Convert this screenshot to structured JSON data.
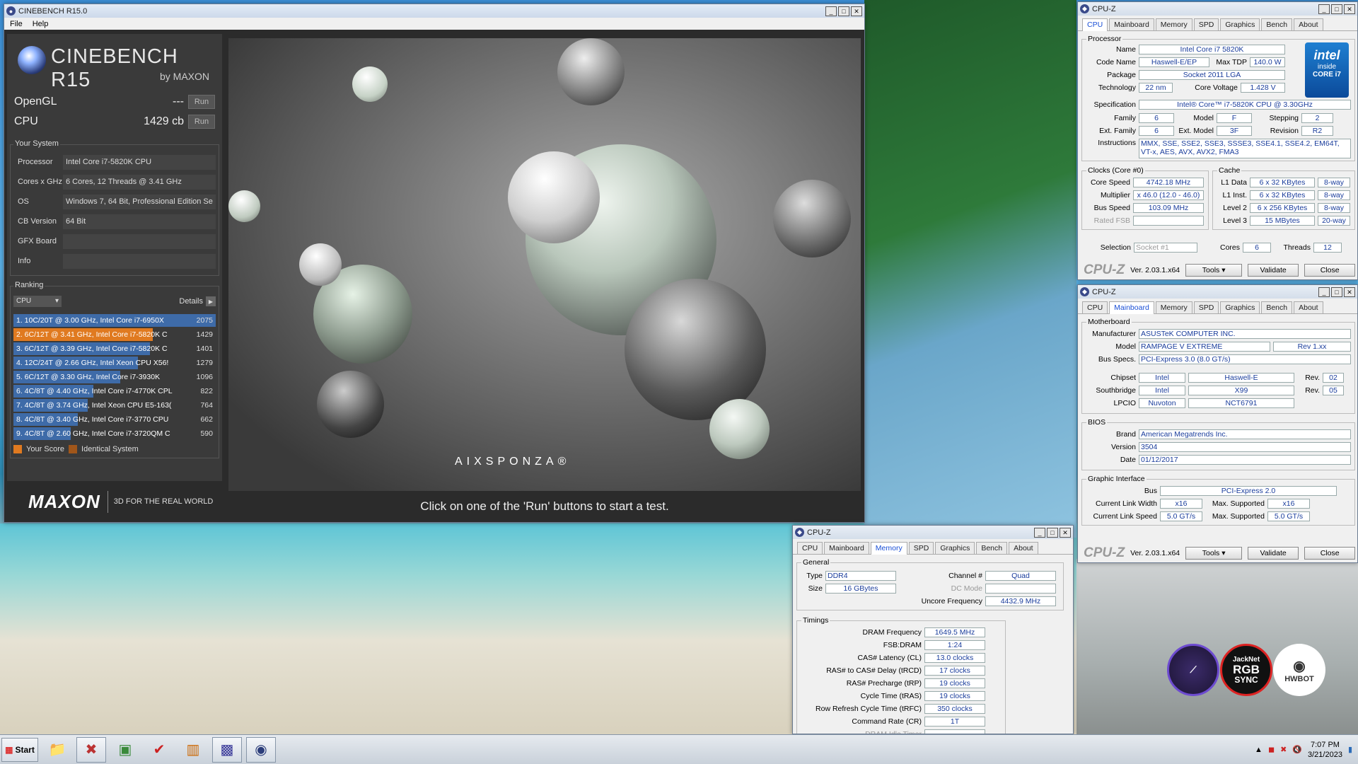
{
  "cinebench": {
    "title": "CINEBENCH R15.0",
    "menu": [
      "File",
      "Help"
    ],
    "logo_title": "CINEBENCH R15",
    "logo_sub": "by MAXON",
    "tests": [
      {
        "label": "OpenGL",
        "value": "---",
        "btn": "Run"
      },
      {
        "label": "CPU",
        "value": "1429 cb",
        "btn": "Run"
      }
    ],
    "your_system_label": "Your System",
    "system": [
      {
        "k": "Processor",
        "v": "Intel Core i7-5820K CPU"
      },
      {
        "k": "Cores x GHz",
        "v": "6 Cores, 12 Threads @ 3.41 GHz"
      },
      {
        "k": "OS",
        "v": "Windows 7, 64 Bit, Professional Edition Se"
      },
      {
        "k": "CB Version",
        "v": "64 Bit"
      },
      {
        "k": "GFX Board",
        "v": ""
      },
      {
        "k": "Info",
        "v": ""
      }
    ],
    "ranking_label": "Ranking",
    "ranking_select": "CPU",
    "details_label": "Details",
    "ranking": [
      {
        "text": "1. 10C/20T @ 3.00 GHz, Intel Core i7-6950X",
        "score": "2075",
        "frac": 1.0,
        "me": false
      },
      {
        "text": "2. 6C/12T @ 3.41 GHz, Intel Core i7-5820K C",
        "score": "1429",
        "frac": 0.69,
        "me": true
      },
      {
        "text": "3. 6C/12T @ 3.39 GHz, Intel Core i7-5820K C",
        "score": "1401",
        "frac": 0.675,
        "me": false
      },
      {
        "text": "4. 12C/24T @ 2.66 GHz, Intel Xeon CPU X56!",
        "score": "1279",
        "frac": 0.616,
        "me": false
      },
      {
        "text": "5. 6C/12T @ 3.30 GHz,  Intel Core i7-3930K",
        "score": "1096",
        "frac": 0.528,
        "me": false
      },
      {
        "text": "6. 4C/8T @ 4.40 GHz, Intel Core i7-4770K CPL",
        "score": "822",
        "frac": 0.396,
        "me": false
      },
      {
        "text": "7. 4C/8T @ 3.74 GHz, Intel Xeon CPU E5-163(",
        "score": "764",
        "frac": 0.368,
        "me": false
      },
      {
        "text": "8. 4C/8T @ 3.40 GHz,  Intel Core i7-3770 CPU",
        "score": "662",
        "frac": 0.319,
        "me": false
      },
      {
        "text": "9. 4C/8T @ 2.60 GHz, Intel Core i7-3720QM C",
        "score": "590",
        "frac": 0.284,
        "me": false
      }
    ],
    "legend_your": "Your Score",
    "legend_ident": "Identical System",
    "footer_brand": "MAXON",
    "footer_slogan": "3D FOR THE REAL WORLD",
    "render_brand": "AIXSPONZA®",
    "message": "Click on one of the 'Run' buttons to start a test."
  },
  "cpuz_cpu": {
    "title": "CPU-Z",
    "tabs": [
      "CPU",
      "Mainboard",
      "Memory",
      "SPD",
      "Graphics",
      "Bench",
      "About"
    ],
    "processor_label": "Processor",
    "name_l": "Name",
    "name": "Intel Core i7 5820K",
    "codename_l": "Code Name",
    "codename": "Haswell-E/EP",
    "tdp_l": "Max TDP",
    "tdp": "140.0 W",
    "package_l": "Package",
    "package": "Socket 2011 LGA",
    "tech_l": "Technology",
    "tech": "22 nm",
    "voltage_l": "Core Voltage",
    "voltage": "1.428 V",
    "spec_l": "Specification",
    "spec": "Intel® Core™ i7-5820K CPU @ 3.30GHz",
    "family_l": "Family",
    "family": "6",
    "model_l": "Model",
    "model": "F",
    "stepping_l": "Stepping",
    "stepping": "2",
    "extfam_l": "Ext. Family",
    "extfam": "6",
    "extmodel_l": "Ext. Model",
    "extmodel": "3F",
    "revision_l": "Revision",
    "revision": "R2",
    "instr_l": "Instructions",
    "instr": "MMX, SSE, SSE2, SSE3, SSSE3, SSE4.1, SSE4.2, EM64T, VT-x, AES, AVX, AVX2, FMA3",
    "clocks_label": "Clocks (Core #0)",
    "corespeed_l": "Core Speed",
    "corespeed": "4742.18 MHz",
    "mult_l": "Multiplier",
    "mult": "x 46.0 (12.0 - 46.0)",
    "bus_l": "Bus Speed",
    "bus": "103.09 MHz",
    "fsb_l": "Rated FSB",
    "fsb": "",
    "cache_label": "Cache",
    "l1d_l": "L1 Data",
    "l1d": "6 x 32 KBytes",
    "l1d_w": "8-way",
    "l1i_l": "L1 Inst.",
    "l1i": "6 x 32 KBytes",
    "l1i_w": "8-way",
    "l2_l": "Level 2",
    "l2": "6 x 256 KBytes",
    "l2_w": "8-way",
    "l3_l": "Level 3",
    "l3": "15 MBytes",
    "l3_w": "20-way",
    "sel_l": "Selection",
    "sel": "Socket #1",
    "cores_l": "Cores",
    "cores": "6",
    "threads_l": "Threads",
    "threads": "12",
    "intel_1": "intel",
    "intel_2": "inside",
    "intel_3": "CORE i7",
    "logo": "CPU-Z",
    "ver": "Ver. 2.03.1.x64",
    "tools": "Tools",
    "validate": "Validate",
    "close": "Close"
  },
  "cpuz_mb": {
    "title": "CPU-Z",
    "tabs": [
      "CPU",
      "Mainboard",
      "Memory",
      "SPD",
      "Graphics",
      "Bench",
      "About"
    ],
    "mb_label": "Motherboard",
    "manu_l": "Manufacturer",
    "manu": "ASUSTeK COMPUTER INC.",
    "model_l": "Model",
    "model": "RAMPAGE V EXTREME",
    "model_rev": "Rev 1.xx",
    "busspec_l": "Bus Specs.",
    "busspec": "PCI-Express 3.0 (8.0 GT/s)",
    "chipset_l": "Chipset",
    "chipset_v": "Intel",
    "chipset_n": "Haswell-E",
    "chipset_rev_l": "Rev.",
    "chipset_rev": "02",
    "south_l": "Southbridge",
    "south_v": "Intel",
    "south_n": "X99",
    "south_rev_l": "Rev.",
    "south_rev": "05",
    "lpcio_l": "LPCIO",
    "lpcio_v": "Nuvoton",
    "lpcio_n": "NCT6791",
    "bios_label": "BIOS",
    "brand_l": "Brand",
    "brand": "American Megatrends Inc.",
    "version_l": "Version",
    "version": "3504",
    "date_l": "Date",
    "date": "01/12/2017",
    "gi_label": "Graphic Interface",
    "gbus_l": "Bus",
    "gbus": "PCI-Express 2.0",
    "clw_l": "Current Link Width",
    "clw": "x16",
    "msw_l": "Max. Supported",
    "msw": "x16",
    "cls_l": "Current Link Speed",
    "cls": "5.0 GT/s",
    "mss_l": "Max. Supported",
    "mss": "5.0 GT/s",
    "logo": "CPU-Z",
    "ver": "Ver. 2.03.1.x64",
    "tools": "Tools",
    "validate": "Validate",
    "close": "Close"
  },
  "cpuz_mem": {
    "title": "CPU-Z",
    "tabs": [
      "CPU",
      "Mainboard",
      "Memory",
      "SPD",
      "Graphics",
      "Bench",
      "About"
    ],
    "general_label": "General",
    "type_l": "Type",
    "type": "DDR4",
    "size_l": "Size",
    "size": "16 GBytes",
    "chan_l": "Channel #",
    "chan": "Quad",
    "dc_l": "DC Mode",
    "dc": "",
    "unc_l": "Uncore Frequency",
    "unc": "4432.9 MHz",
    "timings_label": "Timings",
    "timings": [
      {
        "k": "DRAM Frequency",
        "v": "1649.5 MHz"
      },
      {
        "k": "FSB:DRAM",
        "v": "1:24"
      },
      {
        "k": "CAS# Latency (CL)",
        "v": "13.0 clocks"
      },
      {
        "k": "RAS# to CAS# Delay (tRCD)",
        "v": "17 clocks"
      },
      {
        "k": "RAS# Precharge (tRP)",
        "v": "19 clocks"
      },
      {
        "k": "Cycle Time (tRAS)",
        "v": "19 clocks"
      },
      {
        "k": "Row Refresh Cycle Time (tRFC)",
        "v": "350 clocks"
      },
      {
        "k": "Command Rate (CR)",
        "v": "1T"
      },
      {
        "k": "DRAM Idle Timer",
        "v": ""
      }
    ]
  },
  "taskbar": {
    "start": "Start",
    "time": "7:07 PM",
    "date": "3/21/2023"
  },
  "badges": {
    "rgb_1": "JackNet",
    "rgb_2": "RGB",
    "rgb_3": "SYNC",
    "hwbot": "HWBOT"
  }
}
